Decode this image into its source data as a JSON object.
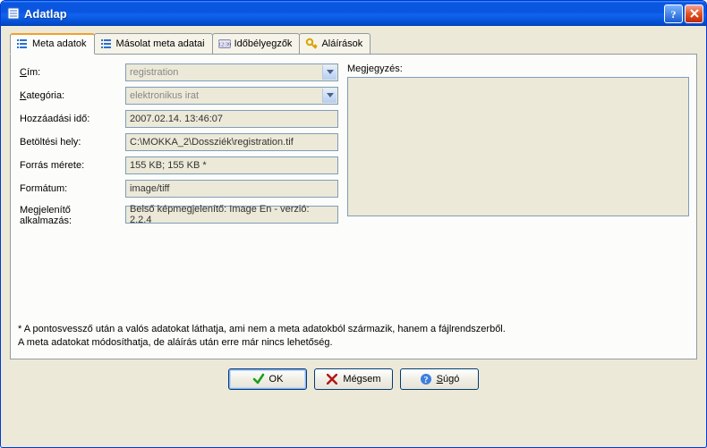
{
  "window": {
    "title": "Adatlap"
  },
  "tabs": [
    {
      "label": "Meta adatok"
    },
    {
      "label": "Másolat meta adatai"
    },
    {
      "label": "Időbélyegzők"
    },
    {
      "label": "Aláírások"
    }
  ],
  "form": {
    "cim_label": "Cím:",
    "cim_value": "registration",
    "kategoria_label": "Kategória:",
    "kategoria_value": "elektronikus irat",
    "hozzaadasi_label": "Hozzáadási idő:",
    "hozzaadasi_value": "2007.02.14. 13:46:07",
    "betoltesi_label": "Betöltési hely:",
    "betoltesi_value": "C:\\MOKKA_2\\Dossziék\\registration.tif",
    "forras_label": "Forrás mérete:",
    "forras_value": "155 KB; 155 KB *",
    "formatum_label": "Formátum:",
    "formatum_value": "image/tiff",
    "megjelenito_label_l1": "Megjelenítő",
    "megjelenito_label_l2": "alkalmazás:",
    "megjelenito_value": "Belső képmegjelenítő: Image En - verzió: 2.2.4"
  },
  "notes_label": "Megjegyzés:",
  "footnote_l1": "* A pontosvessző után a valós adatokat láthatja, ami nem a meta adatokból származik, hanem a fájlrendszerből.",
  "footnote_l2": "A meta adatokat módosíthatja, de aláírás után erre már nincs lehetőség.",
  "buttons": {
    "ok": "OK",
    "cancel": "Mégsem",
    "help": "Súgó"
  }
}
